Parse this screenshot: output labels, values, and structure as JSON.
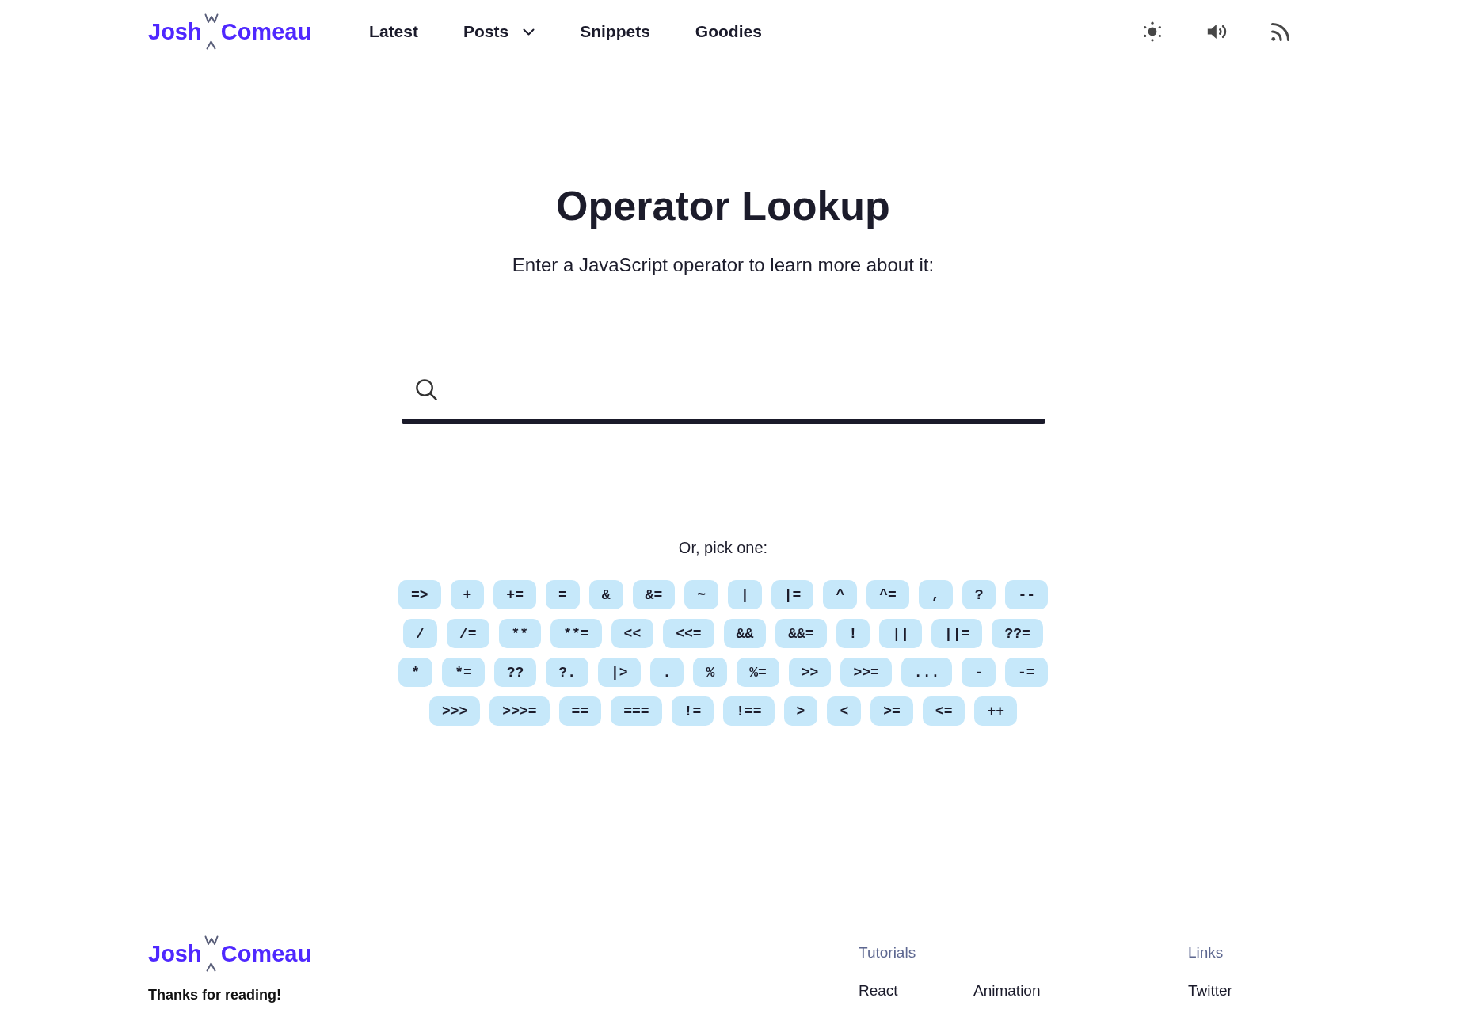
{
  "header": {
    "logo": {
      "first": "Josh",
      "last": "Comeau"
    },
    "nav": [
      {
        "label": "Latest",
        "kind": "link"
      },
      {
        "label": "Posts",
        "kind": "dropdown"
      },
      {
        "label": "Snippets",
        "kind": "link"
      },
      {
        "label": "Goodies",
        "kind": "link"
      }
    ]
  },
  "main": {
    "title": "Operator Lookup",
    "subtitle": "Enter a JavaScript operator to learn more about it:",
    "pick_label": "Or, pick one:",
    "operator_rows": [
      [
        "=>",
        "+",
        "+=",
        "=",
        "&",
        "&=",
        "~",
        "|",
        "|=",
        "^",
        "^=",
        ",",
        "?",
        "--"
      ],
      [
        "/",
        "/=",
        "**",
        "**=",
        "<<",
        "<<=",
        "&&",
        "&&=",
        "!",
        "||",
        "||=",
        "??="
      ],
      [
        "*",
        "*=",
        "??",
        "?.",
        "|>",
        ".",
        "%",
        "%=",
        ">>",
        ">>=",
        "...",
        "-",
        "-="
      ],
      [
        ">>>",
        ">>>=",
        "==",
        "===",
        "!=",
        "!==",
        ">",
        "<",
        ">=",
        "<=",
        "++"
      ]
    ]
  },
  "footer": {
    "logo": {
      "first": "Josh",
      "last": "Comeau"
    },
    "tagline": "Thanks for reading!",
    "columns": [
      {
        "heading": "Tutorials",
        "links": [
          "React",
          "Animation"
        ]
      },
      {
        "heading": "Links",
        "links": [
          "Twitter"
        ]
      }
    ]
  }
}
